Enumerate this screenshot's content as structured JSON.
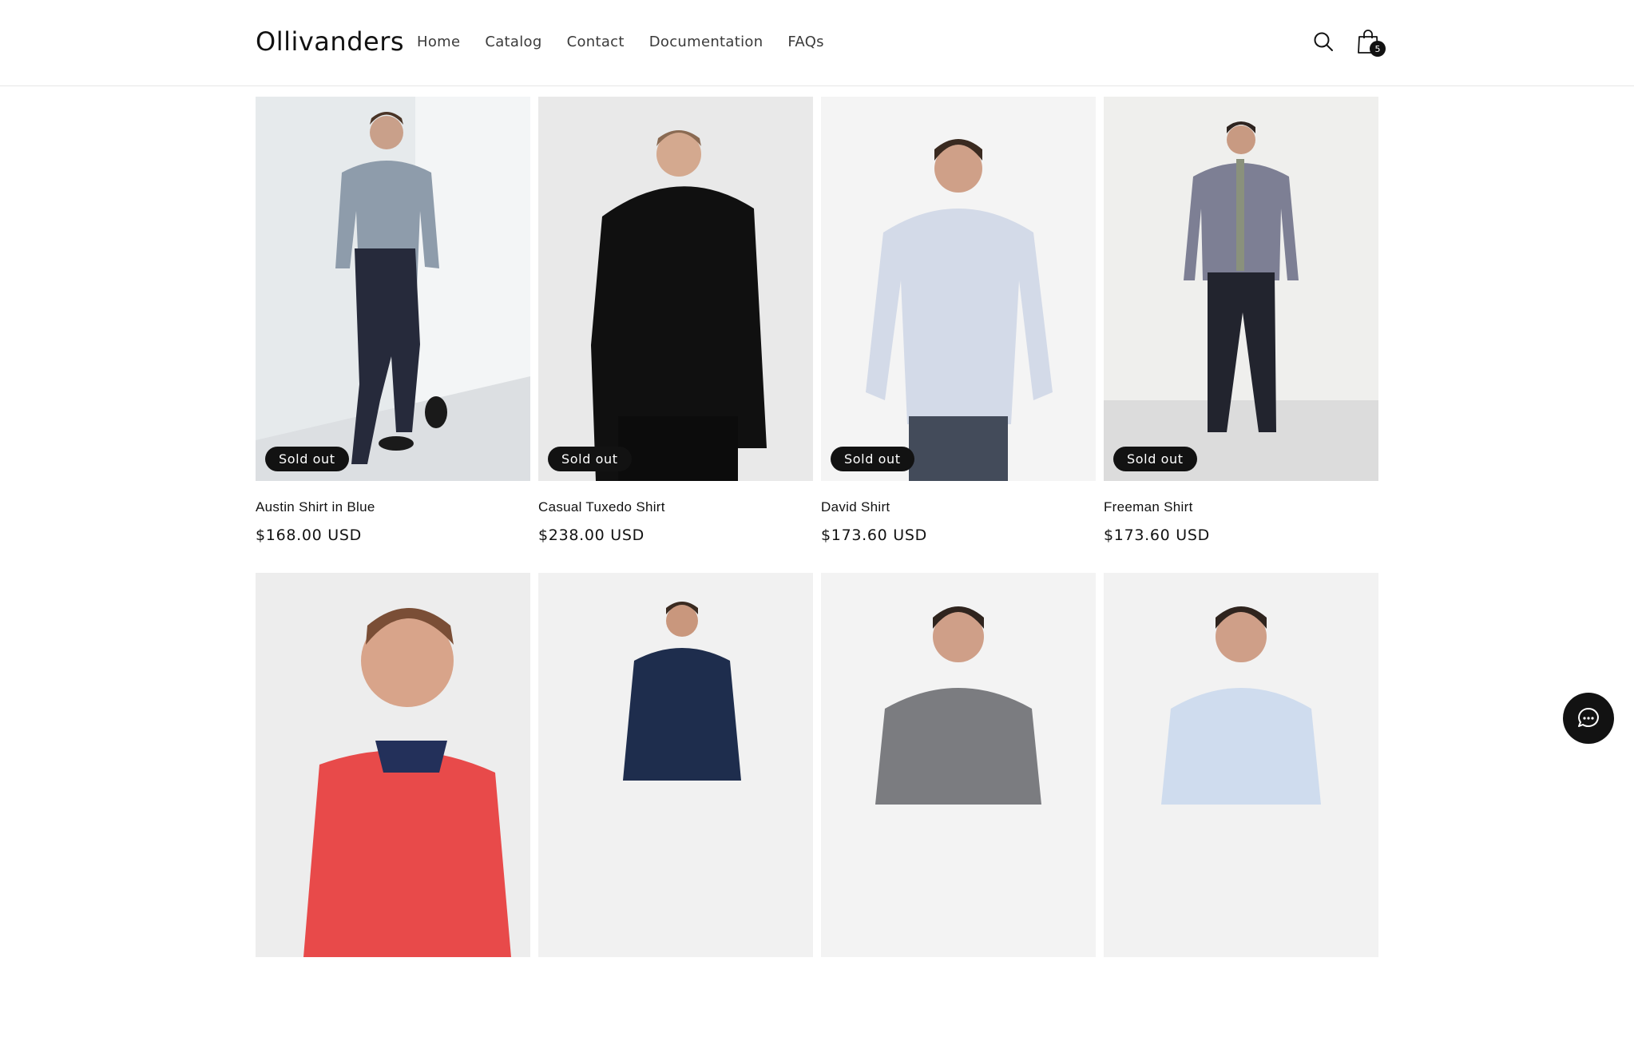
{
  "header": {
    "logo": "Ollivanders",
    "nav": [
      "Home",
      "Catalog",
      "Contact",
      "Documentation",
      "FAQs"
    ],
    "cart_count": "5",
    "search_icon": "search-icon",
    "cart_icon": "shopping-bag-icon"
  },
  "products": [
    {
      "title": "Austin Shirt in Blue",
      "price": "$168.00 USD",
      "badge": "Sold out"
    },
    {
      "title": "Casual Tuxedo Shirt",
      "price": "$238.00 USD",
      "badge": "Sold out"
    },
    {
      "title": "David Shirt",
      "price": "$173.60 USD",
      "badge": "Sold out"
    },
    {
      "title": "Freeman Shirt",
      "price": "$173.60 USD",
      "badge": "Sold out"
    },
    {
      "title": "",
      "price": "",
      "badge": ""
    },
    {
      "title": "",
      "price": "",
      "badge": ""
    },
    {
      "title": "",
      "price": "",
      "badge": ""
    },
    {
      "title": "",
      "price": "",
      "badge": ""
    }
  ],
  "colors": {
    "text": "#121212",
    "badge_bg": "#121212",
    "border": "#e6e6e6"
  },
  "chat": {
    "icon": "chat-bubble-icon"
  }
}
